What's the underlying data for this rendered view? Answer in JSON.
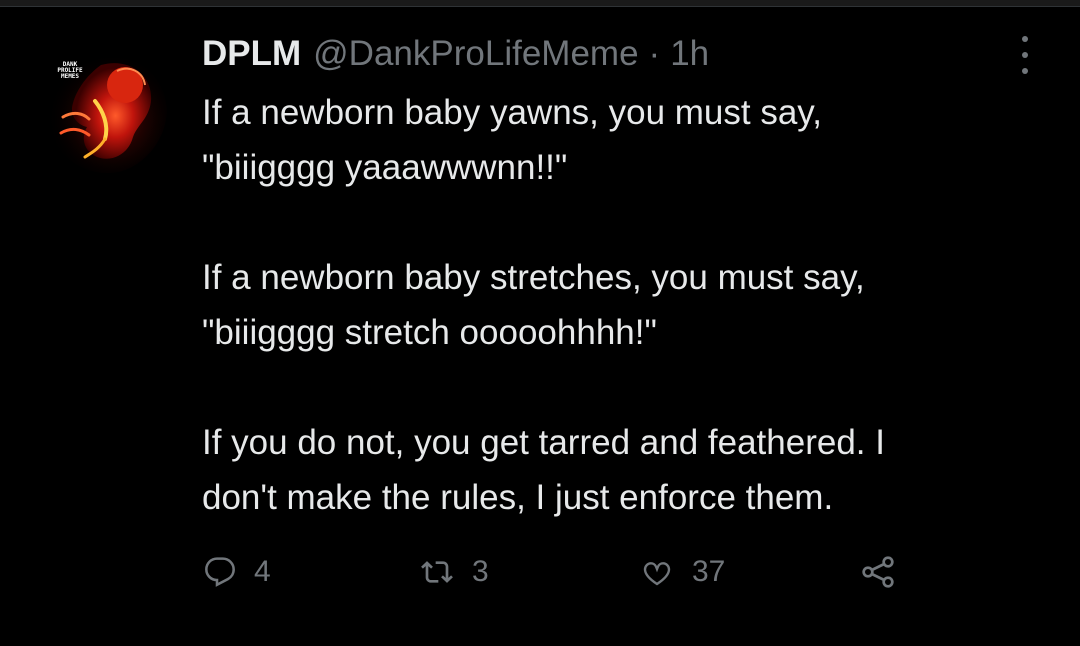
{
  "tweet": {
    "avatar_text": [
      "DANK",
      "PROLIFE",
      "MEMES"
    ],
    "display_name": "DPLM",
    "handle": "@DankProLifeMeme",
    "separator": "·",
    "time": "1h",
    "lines": {
      "l1": "If a newborn baby yawns, you must say,",
      "l2": "\"biiigggg yaaawwwnn!!\"",
      "l3": "If a newborn baby stretches, you must say,",
      "l4": "\"biiigggg stretch ooooohhhh!\"",
      "l5": "If you do not, you get tarred and feathered. I",
      "l6": "don't make the rules, I just enforce them."
    },
    "replies": "4",
    "retweets": "3",
    "likes": "37"
  },
  "icons": {
    "more": "more-icon",
    "reply": "reply-icon",
    "retweet": "retweet-icon",
    "like": "heart-icon",
    "share": "share-icon"
  },
  "colors": {
    "background": "#000000",
    "text": "#e7e9ea",
    "muted": "#71767b",
    "avatar_accent": "#c0140c"
  }
}
